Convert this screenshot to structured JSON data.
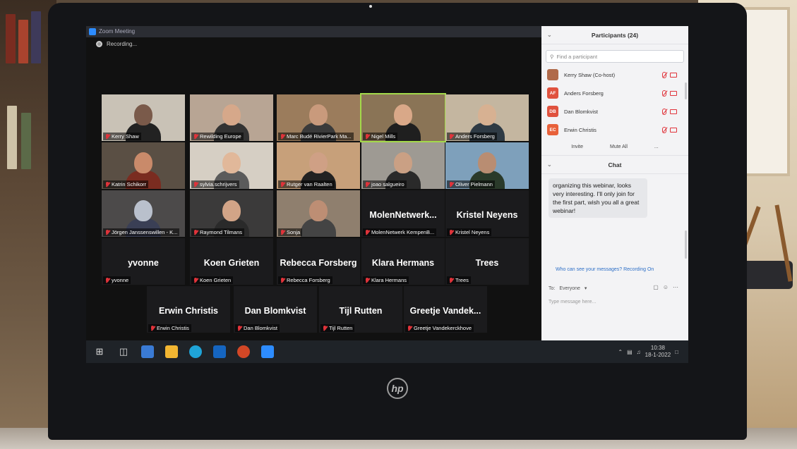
{
  "window": {
    "title": "Zoom Meeting",
    "recording_label": "Recording..."
  },
  "video_tiles": [
    {
      "name": "Kerry Shaw",
      "video": true,
      "active": false
    },
    {
      "name": "Rewilding Europe",
      "video": true,
      "active": false
    },
    {
      "name": "Marc Budé RivierPark Ma...",
      "video": true,
      "active": false
    },
    {
      "name": "Nigel Mills",
      "video": true,
      "active": true
    },
    {
      "name": "Anders Forsberg",
      "video": true,
      "active": false
    },
    {
      "name": "Katrin Schikorr",
      "video": true,
      "active": false
    },
    {
      "name": "sylvia.schrijvers",
      "video": true,
      "active": false
    },
    {
      "name": "Rutger van Raalten",
      "video": true,
      "active": false
    },
    {
      "name": "joao salgueiro",
      "video": true,
      "active": false
    },
    {
      "name": "Oliver Pielmann",
      "video": true,
      "active": false
    },
    {
      "name": "Jörgen Janssenswillen - K...",
      "video": true,
      "active": false
    },
    {
      "name": "Raymond Tilmans",
      "video": true,
      "active": false
    },
    {
      "name": "Sonja",
      "video": true,
      "active": false
    }
  ],
  "name_tiles": [
    {
      "display": "MolenNetwerk...",
      "label": "MolenNetwerk KempenB..."
    },
    {
      "display": "Kristel Neyens",
      "label": "Kristel Neyens"
    },
    {
      "display": "yvonne",
      "label": "yvonne"
    },
    {
      "display": "Koen Grieten",
      "label": "Koen Grieten"
    },
    {
      "display": "Rebecca Forsberg",
      "label": "Rebecca Forsberg"
    },
    {
      "display": "Klara Hermans",
      "label": "Klara Hermans"
    },
    {
      "display": "Trees",
      "label": "Trees"
    },
    {
      "display": "Erwin Christis",
      "label": "Erwin Christis"
    },
    {
      "display": "Dan Blomkvist",
      "label": "Dan Blomkvist"
    },
    {
      "display": "Tijl Rutten",
      "label": "Tijl Rutten"
    },
    {
      "display": "Greetje Vandek...",
      "label": "Greetje Vandekerckhove"
    }
  ],
  "participants_panel": {
    "title": "Participants (24)",
    "search_placeholder": "Find a participant",
    "participants": [
      {
        "name": "Kerry Shaw (Co-host)",
        "initials": "",
        "color": "#b06a4a"
      },
      {
        "name": "Anders Forsberg",
        "initials": "AF",
        "color": "#e0523e"
      },
      {
        "name": "Dan Blomkvist",
        "initials": "DB",
        "color": "#e0523e"
      },
      {
        "name": "Erwin Christis",
        "initials": "EC",
        "color": "#e8613a"
      }
    ],
    "invite_label": "Invite",
    "mute_all_label": "Mute All",
    "more_label": "..."
  },
  "chat_panel": {
    "title": "Chat",
    "message": "organizing this webinar, looks very interesting. I'll only join for the first part, wish you all a great webinar!",
    "privacy_text": "Who can see your messages? Recording On",
    "to_label": "To:",
    "recipient": "Everyone",
    "input_placeholder": "Type message here..."
  },
  "taskbar": {
    "time": "10:38",
    "date": "18-1-2022"
  },
  "brand": "hp"
}
